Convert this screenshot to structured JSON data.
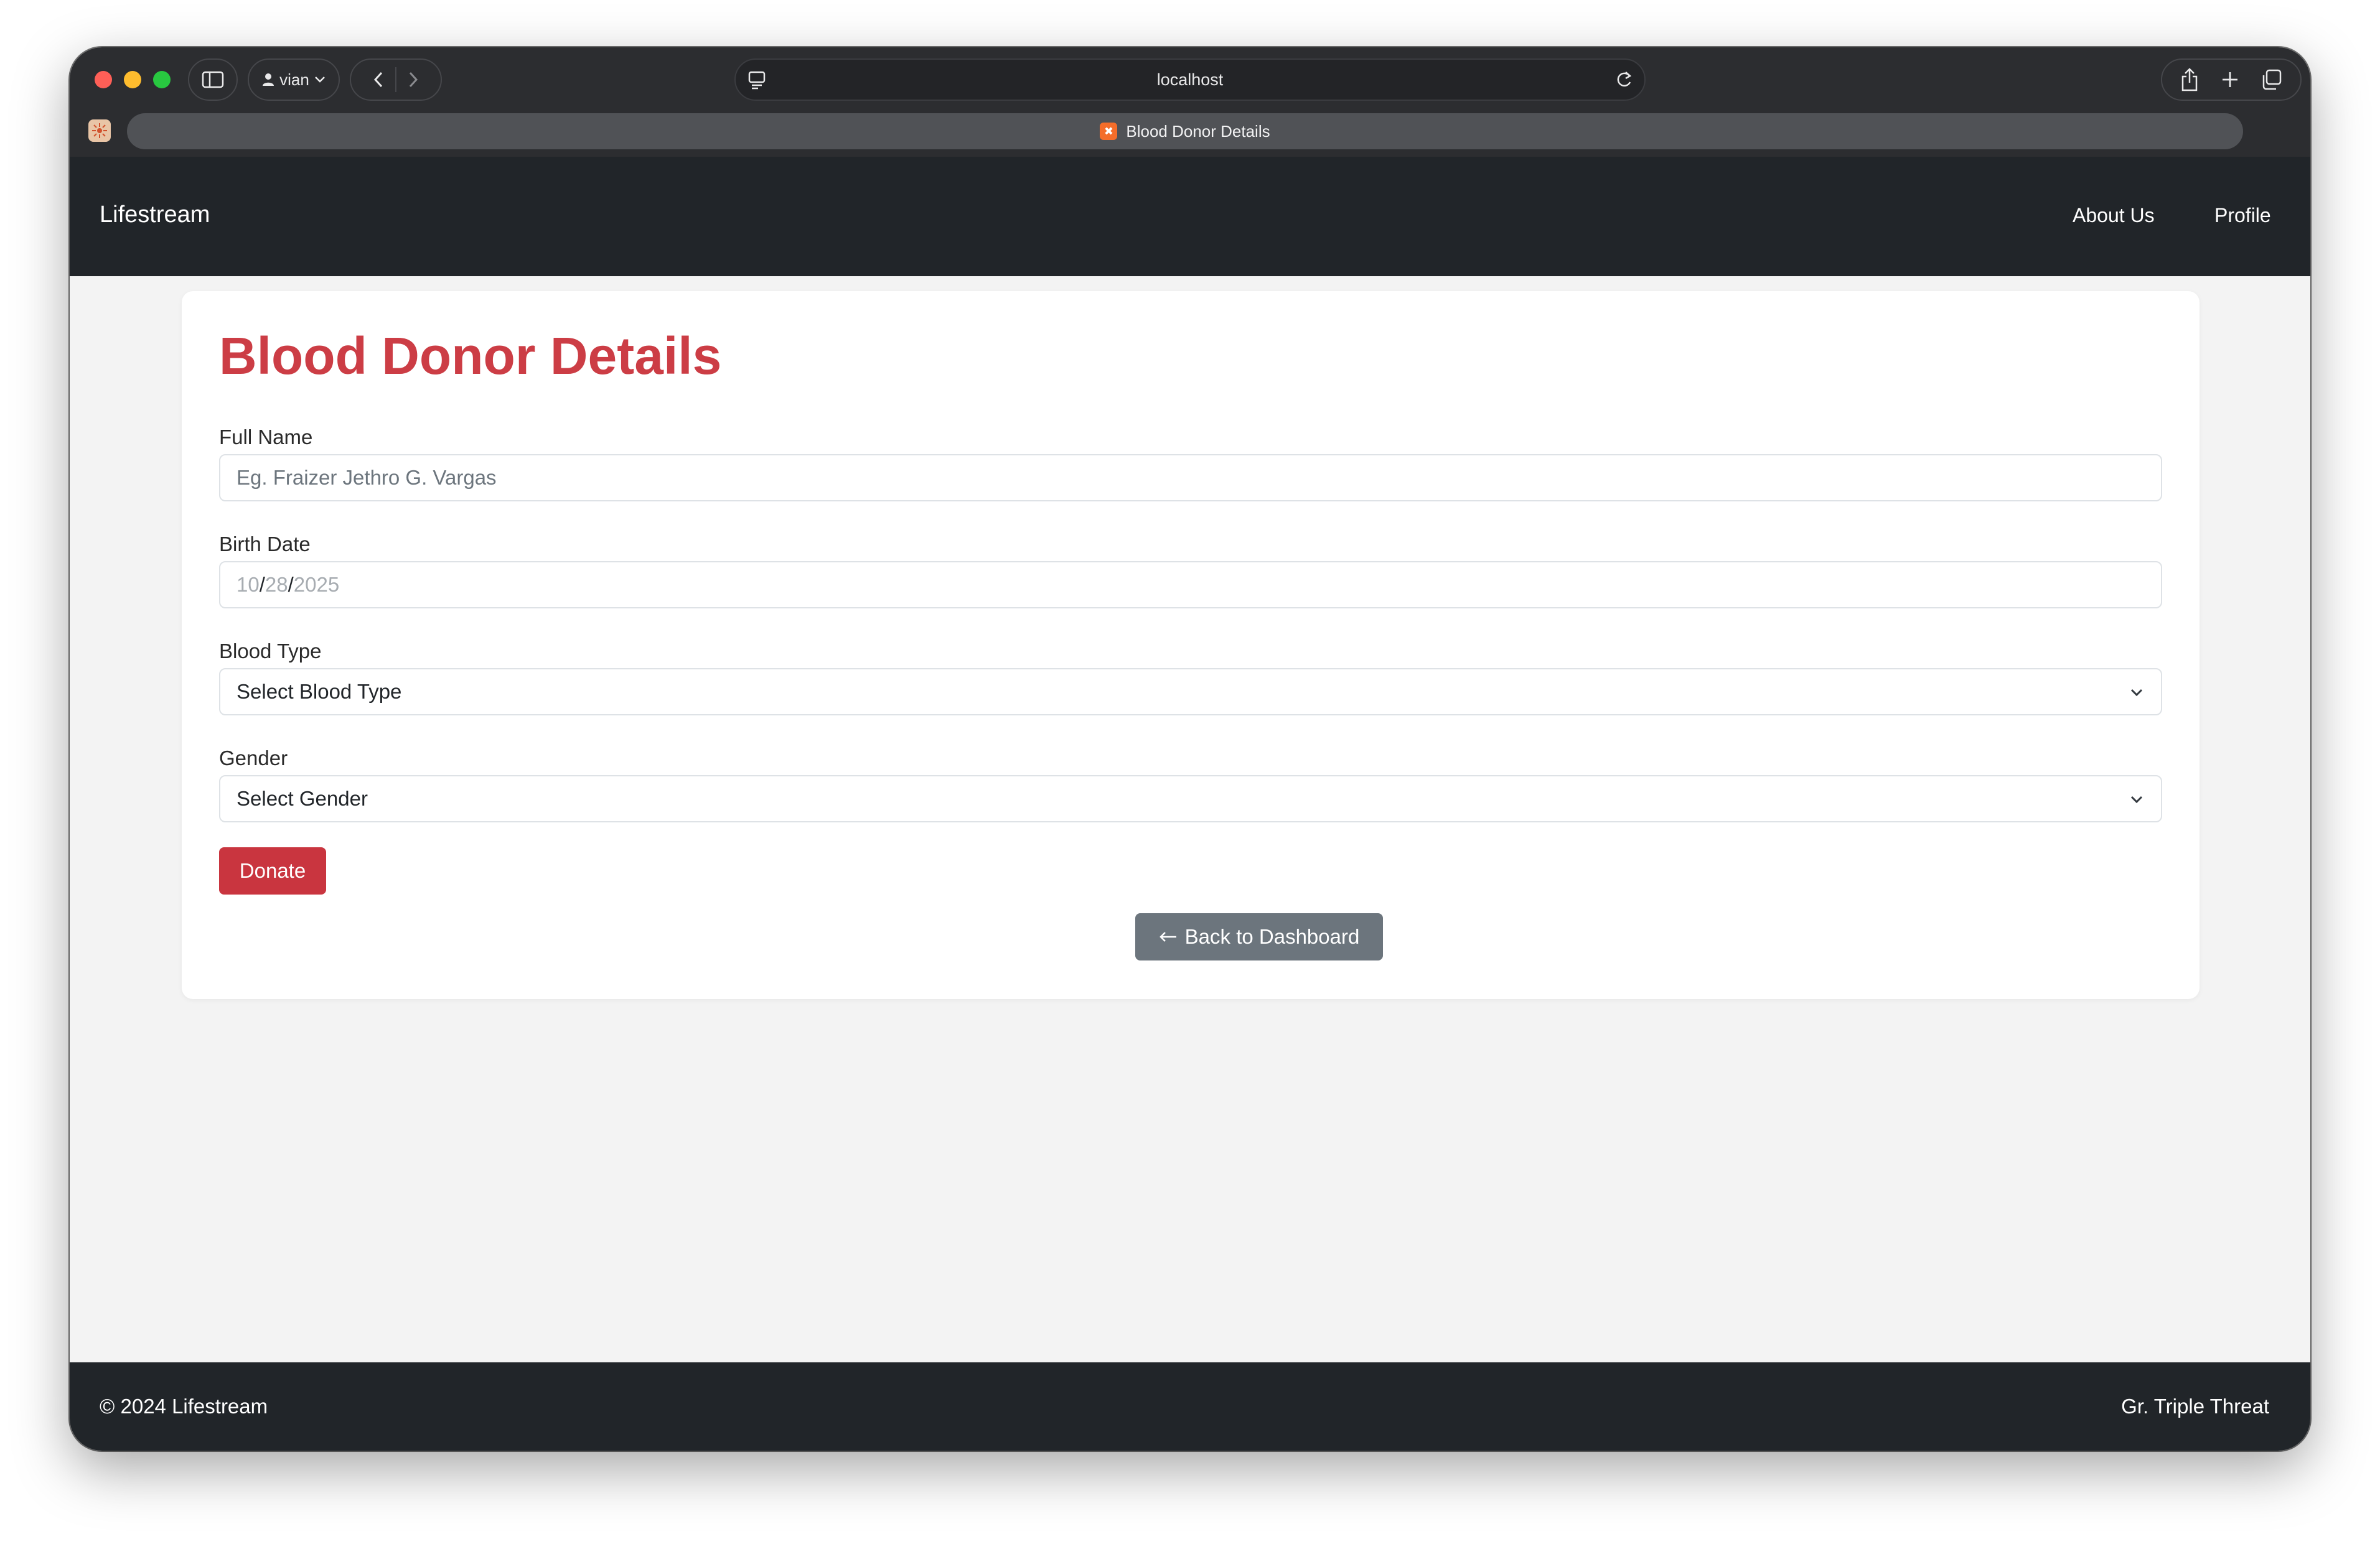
{
  "browser": {
    "profile_name": "vian",
    "address": "localhost",
    "tab_title": "Blood Donor Details",
    "icons": [
      "sidebar-icon",
      "person-icon",
      "chevron-down-icon",
      "back-icon",
      "forward-icon",
      "page-settings-icon",
      "reload-icon",
      "share-icon",
      "plus-icon",
      "tabs-overview-icon"
    ]
  },
  "navbar": {
    "brand": "Lifestream",
    "links": [
      {
        "label": "About Us"
      },
      {
        "label": "Profile"
      }
    ]
  },
  "form": {
    "title": "Blood Donor Details",
    "full_name": {
      "label": "Full Name",
      "placeholder": "Eg. Fraizer Jethro G. Vargas"
    },
    "birth_date": {
      "label": "Birth Date",
      "month": "10",
      "day": "28",
      "year": "2025"
    },
    "blood_type": {
      "label": "Blood Type",
      "selected": "Select Blood Type"
    },
    "gender": {
      "label": "Gender",
      "selected": "Select Gender"
    },
    "submit_label": "Donate",
    "back_label": "Back to Dashboard"
  },
  "footer": {
    "copyright": "© 2024 Lifestream",
    "credit": "Gr. Triple Threat"
  },
  "colors": {
    "accent": "#cc3d45",
    "dark": "#212529",
    "secondary": "#6c757d",
    "background": "#f3f3f3"
  }
}
